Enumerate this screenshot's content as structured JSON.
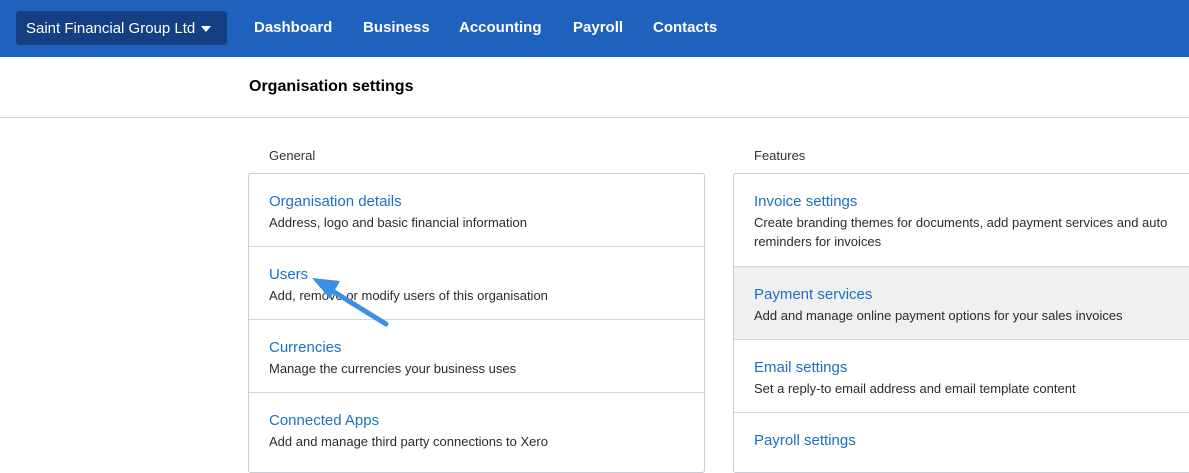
{
  "topbar": {
    "org_name": "Saint Financial Group Ltd",
    "nav": [
      "Dashboard",
      "Business",
      "Accounting",
      "Payroll",
      "Contacts"
    ]
  },
  "page": {
    "title": "Organisation settings"
  },
  "general": {
    "label": "General",
    "items": [
      {
        "title": "Organisation details",
        "desc": "Address, logo and basic financial information"
      },
      {
        "title": "Users",
        "desc": "Add, remove or modify users of this organisation"
      },
      {
        "title": "Currencies",
        "desc": "Manage the currencies your business uses"
      },
      {
        "title": "Connected Apps",
        "desc": "Add and manage third party connections to Xero"
      }
    ]
  },
  "features": {
    "label": "Features",
    "items": [
      {
        "title": "Invoice settings",
        "desc": "Create branding themes for documents, add payment services and auto reminders for invoices"
      },
      {
        "title": "Payment services",
        "desc": "Add and manage online payment options for your sales invoices"
      },
      {
        "title": "Email settings",
        "desc": "Set a reply-to email address and email template content"
      },
      {
        "title": "Payroll settings",
        "desc": ""
      }
    ]
  },
  "colors": {
    "topbar": "#1f62be",
    "org_switcher": "#153f83",
    "link": "#1a70c4",
    "arrow": "#3d8fe6",
    "highlight_row": "#f0f0f1"
  }
}
